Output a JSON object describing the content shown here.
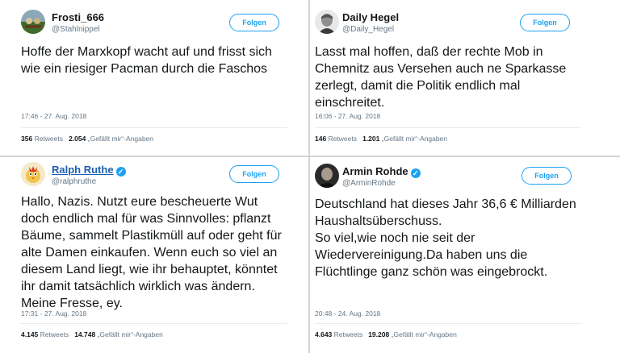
{
  "tweets": [
    {
      "name": "Frosti_666",
      "handle": "@Stahlnippel",
      "follow_label": "Folgen",
      "text": [
        "Hoffe der Marxkopf wacht auf und frisst sich",
        "wie ein riesiger Pacman durch die Faschos"
      ],
      "time": "17:46 - 27. Aug. 2018",
      "retweets": "356",
      "retweets_label": "Retweets",
      "likes": "2.054",
      "likes_label": "„Gefällt mir“-Angaben"
    },
    {
      "name": "Daily Hegel",
      "handle": "@Daily_Hegel",
      "follow_label": "Folgen",
      "text": [
        "Lasst mal hoffen, daß der rechte Mob in",
        "Chemnitz aus Versehen auch ne Sparkasse",
        "zerlegt, damit die Politik endlich mal",
        "einschreitet."
      ],
      "time": "16:06 - 27. Aug. 2018",
      "retweets": "146",
      "retweets_label": "Retweets",
      "likes": "1.201",
      "likes_label": "„Gefällt mir“-Angaben"
    },
    {
      "name": "Ralph Ruthe",
      "handle": "@ralphruthe",
      "follow_label": "Folgen",
      "verified_icon": "verified-badge-icon",
      "text": [
        "Hallo, Nazis. Nutzt eure bescheuerte Wut",
        "doch endlich mal für was Sinnvolles: pflanzt",
        "Bäume, sammelt Plastikmüll auf oder geht für",
        "alte Damen einkaufen. Wenn euch so viel an",
        "diesem Land liegt, wie ihr behauptet, könntet",
        "ihr damit tatsächlich wirklich was ändern.",
        "Meine Fresse, ey."
      ],
      "time": "17:31 - 27. Aug. 2018",
      "retweets": "4.145",
      "retweets_label": "Retweets",
      "likes": "14.748",
      "likes_label": "„Gefällt mir“-Angaben"
    },
    {
      "name": "Armin Rohde",
      "handle": "@ArminRohde",
      "follow_label": "Folgen",
      "verified_icon": "verified-badge-icon",
      "text": [
        "Deutschland hat dieses Jahr 36,6 € Milliarden",
        "Haushaltsüberschuss.",
        "So viel,wie noch nie seit der",
        "Wiedervereinigung.Da haben uns die",
        "Flüchtlinge ganz schön was eingebrockt."
      ],
      "time": "20:48 - 24. Aug. 2018",
      "retweets": "4.643",
      "retweets_label": "Retweets",
      "likes": "19.208",
      "likes_label": "„Gefällt mir“-Angaben"
    }
  ],
  "colors": {
    "accent": "#1da1f2",
    "text": "#14171a",
    "muted": "#657786",
    "divider": "#d0d4d8"
  }
}
